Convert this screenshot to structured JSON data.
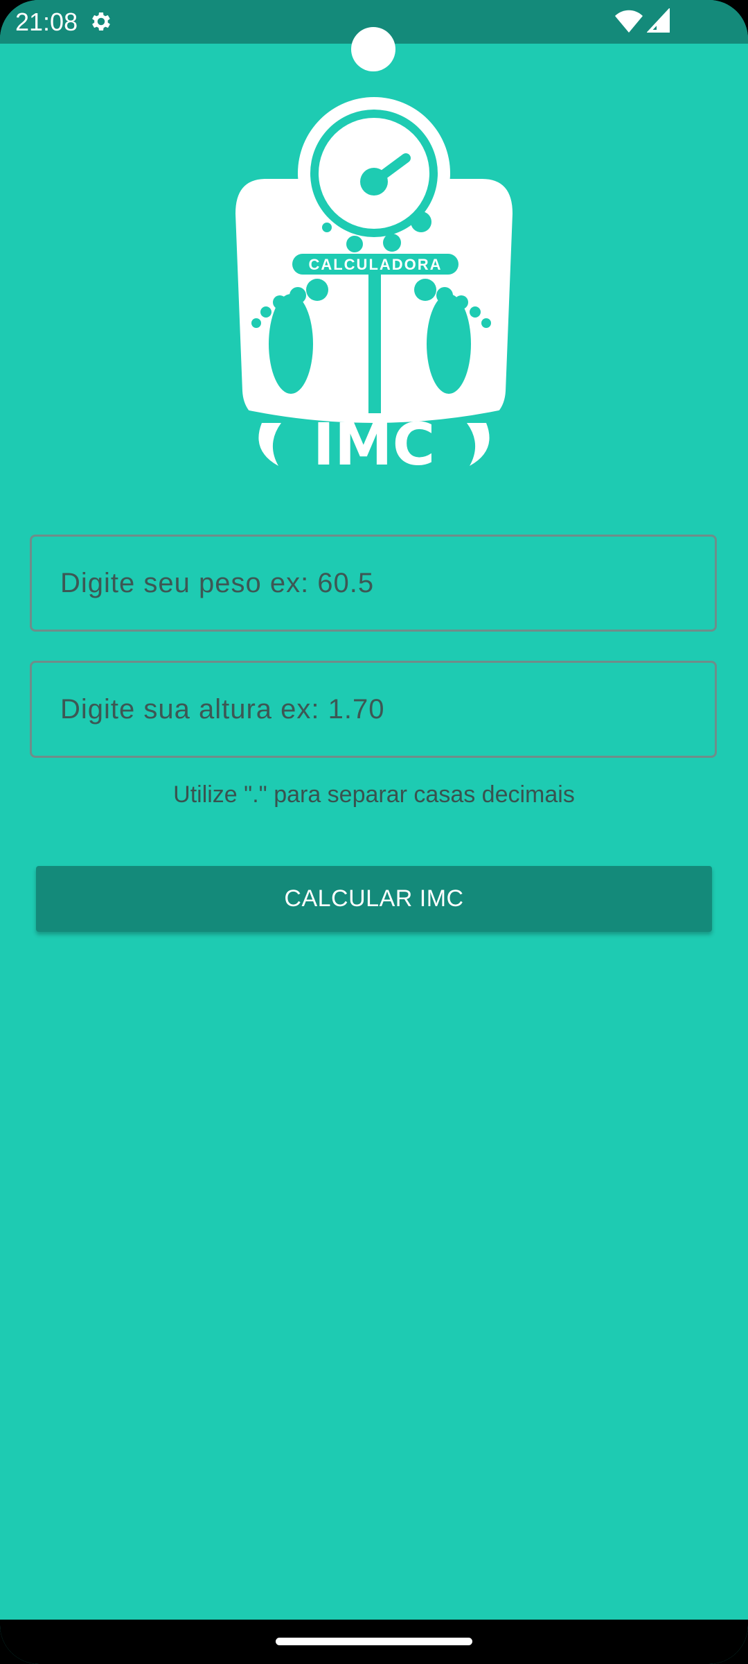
{
  "status_bar": {
    "time": "21:08",
    "icons": [
      "gear-icon",
      "wifi-icon",
      "signal-icon"
    ]
  },
  "logo": {
    "top_text": "CALCULADORA",
    "main_text": "IMC"
  },
  "form": {
    "weight_placeholder": "Digite seu peso ex: 60.5",
    "height_placeholder": "Digite sua altura ex: 1.70",
    "hint": "Utilize \".\" para separar casas decimais",
    "calculate_label": "CALCULAR IMC"
  },
  "colors": {
    "background": "#1ecbb2",
    "status_bar": "#148a7a",
    "button": "#148a7a",
    "text": "#39524f"
  }
}
